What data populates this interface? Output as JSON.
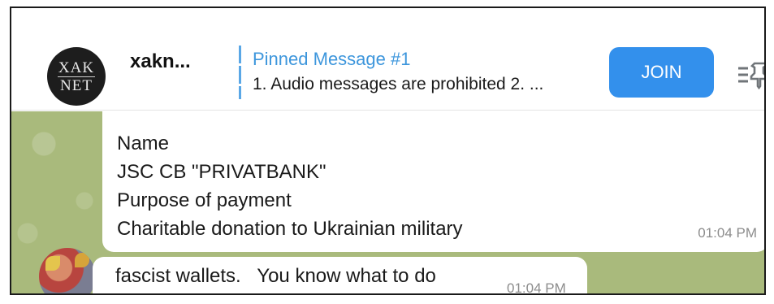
{
  "header": {
    "avatar_text": [
      "XAK",
      "NET"
    ],
    "channel_name": "xakn...",
    "pinned_title": "Pinned Message #1",
    "pinned_text": "1. Audio messages are prohibited 2. ...",
    "join_label": "JOIN",
    "pin_list_icon": "pinned-list-icon"
  },
  "messages": [
    {
      "lines": [
        "Name",
        "JSC CB \"PRIVATBANK\"",
        "Purpose of payment",
        "Charitable donation to Ukrainian military"
      ],
      "time": "01:04 PM"
    },
    {
      "text": "fascist wallets.   You know what to do",
      "time": "01:04 PM"
    }
  ],
  "colors": {
    "accent": "#3390ec",
    "pinned_title": "#3d96dc",
    "chat_background": "#a9ba7c"
  }
}
